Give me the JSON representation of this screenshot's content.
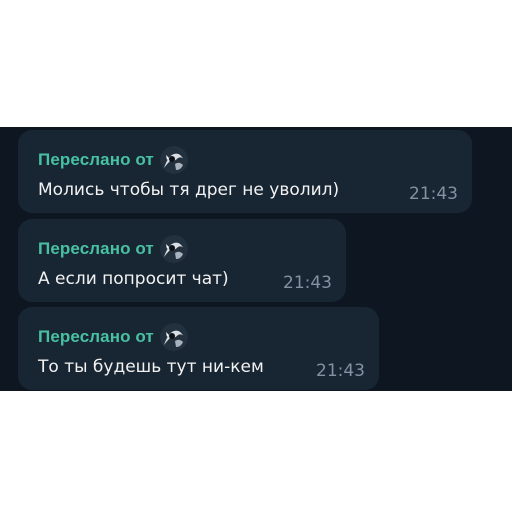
{
  "colors": {
    "chat_background": "#0e1621",
    "bubble": "#182533",
    "forwarded_label": "#48c1a3",
    "message_text": "#f2f2f2",
    "timestamp": "#8292a3"
  },
  "messages": [
    {
      "forwarded_label": "Переслано от",
      "avatar_icon": "forwarded-sender-avatar",
      "text": "Молись чтобы тя дрег не уволил)",
      "time": "21:43"
    },
    {
      "forwarded_label": "Переслано от",
      "avatar_icon": "forwarded-sender-avatar",
      "text": "А если попросит чат)",
      "time": "21:43"
    },
    {
      "forwarded_label": "Переслано от",
      "avatar_icon": "forwarded-sender-avatar",
      "text": "То ты будешь тут ни-кем",
      "time": "21:43"
    }
  ]
}
